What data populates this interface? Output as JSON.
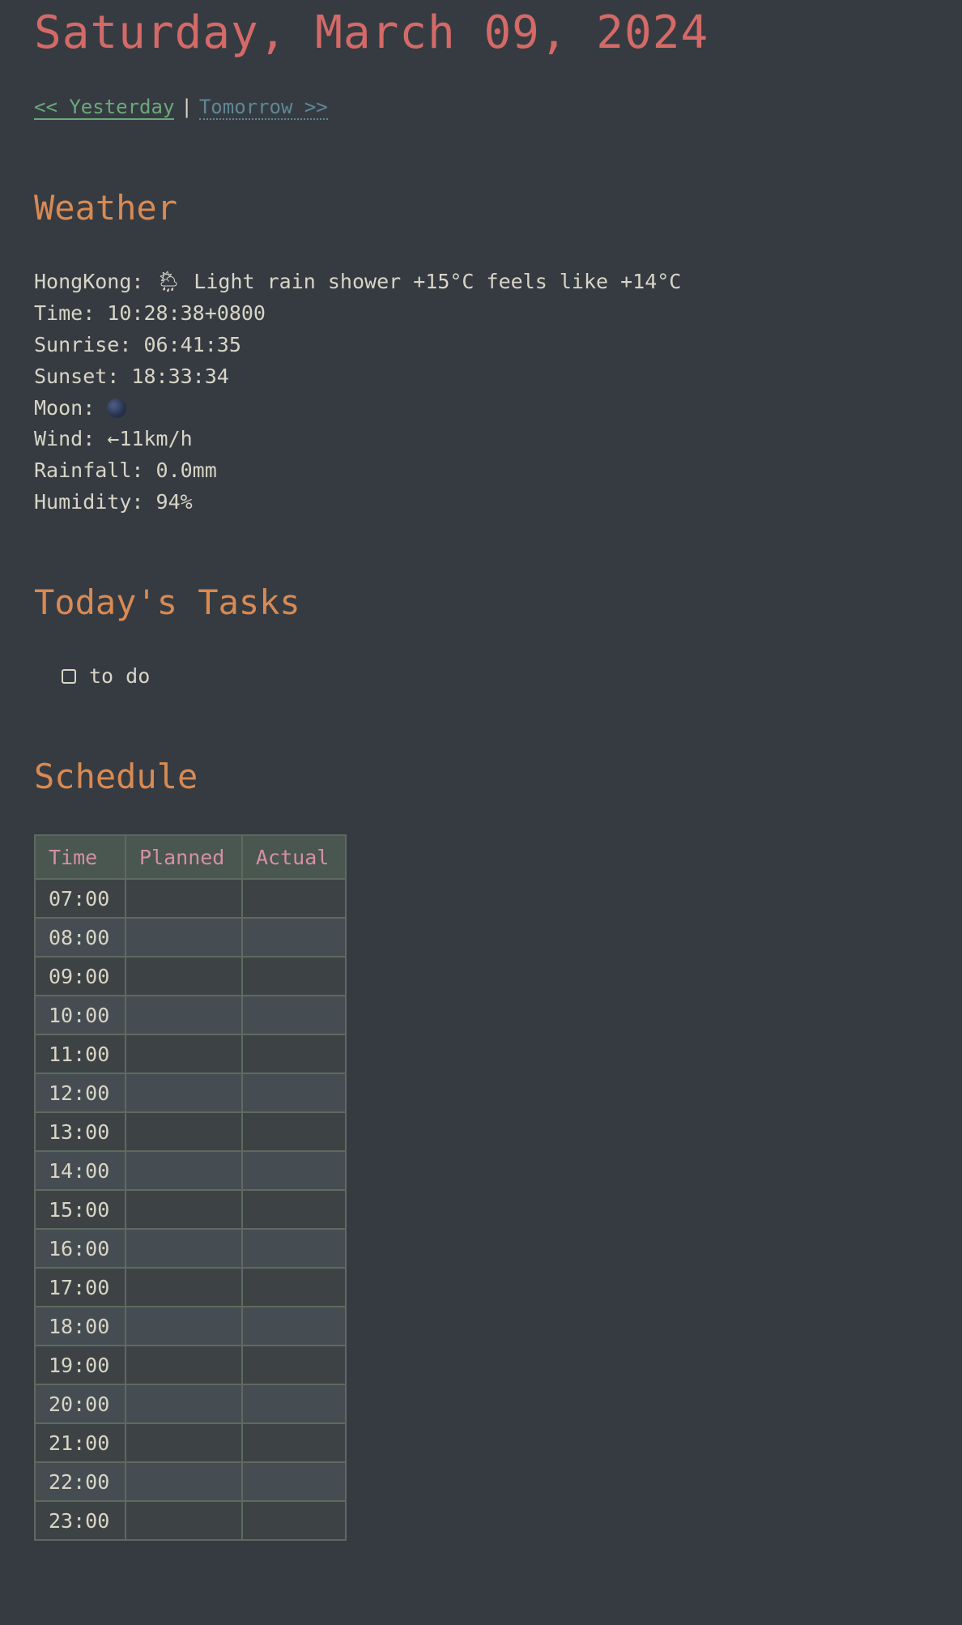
{
  "title": "Saturday, March 09, 2024",
  "nav": {
    "yesterday": "<< Yesterday",
    "separator": "|",
    "tomorrow": "Tomorrow >>"
  },
  "weather": {
    "heading": "Weather",
    "location_line": "HongKong: 🌦 Light rain shower +15°C feels like +14°C",
    "time": "Time: 10:28:38+0800",
    "sunrise": "Sunrise: 06:41:35",
    "sunset": "Sunset: 18:33:34",
    "moon_label": "Moon:",
    "moon_icon": "new-moon-icon",
    "wind": "Wind: ←11km/h",
    "rainfall": "Rainfall: 0.0mm",
    "humidity": "Humidity: 94%"
  },
  "tasks": {
    "heading": "Today's Tasks",
    "items": [
      {
        "label": "to do",
        "checked": false
      }
    ]
  },
  "schedule": {
    "heading": "Schedule",
    "columns": [
      "Time",
      "Planned",
      "Actual"
    ],
    "rows": [
      {
        "time": "07:00",
        "planned": "",
        "actual": ""
      },
      {
        "time": "08:00",
        "planned": "",
        "actual": ""
      },
      {
        "time": "09:00",
        "planned": "",
        "actual": ""
      },
      {
        "time": "10:00",
        "planned": "",
        "actual": ""
      },
      {
        "time": "11:00",
        "planned": "",
        "actual": ""
      },
      {
        "time": "12:00",
        "planned": "",
        "actual": ""
      },
      {
        "time": "13:00",
        "planned": "",
        "actual": ""
      },
      {
        "time": "14:00",
        "planned": "",
        "actual": ""
      },
      {
        "time": "15:00",
        "planned": "",
        "actual": ""
      },
      {
        "time": "16:00",
        "planned": "",
        "actual": ""
      },
      {
        "time": "17:00",
        "planned": "",
        "actual": ""
      },
      {
        "time": "18:00",
        "planned": "",
        "actual": ""
      },
      {
        "time": "19:00",
        "planned": "",
        "actual": ""
      },
      {
        "time": "20:00",
        "planned": "",
        "actual": ""
      },
      {
        "time": "21:00",
        "planned": "",
        "actual": ""
      },
      {
        "time": "22:00",
        "planned": "",
        "actual": ""
      },
      {
        "time": "23:00",
        "planned": "",
        "actual": ""
      }
    ]
  },
  "colors": {
    "background": "#363b42",
    "title": "#d46a67",
    "heading": "#d98a52",
    "link_yesterday": "#6aa97a",
    "link_tomorrow": "#5f8796",
    "table_header": "#d58fa8"
  }
}
